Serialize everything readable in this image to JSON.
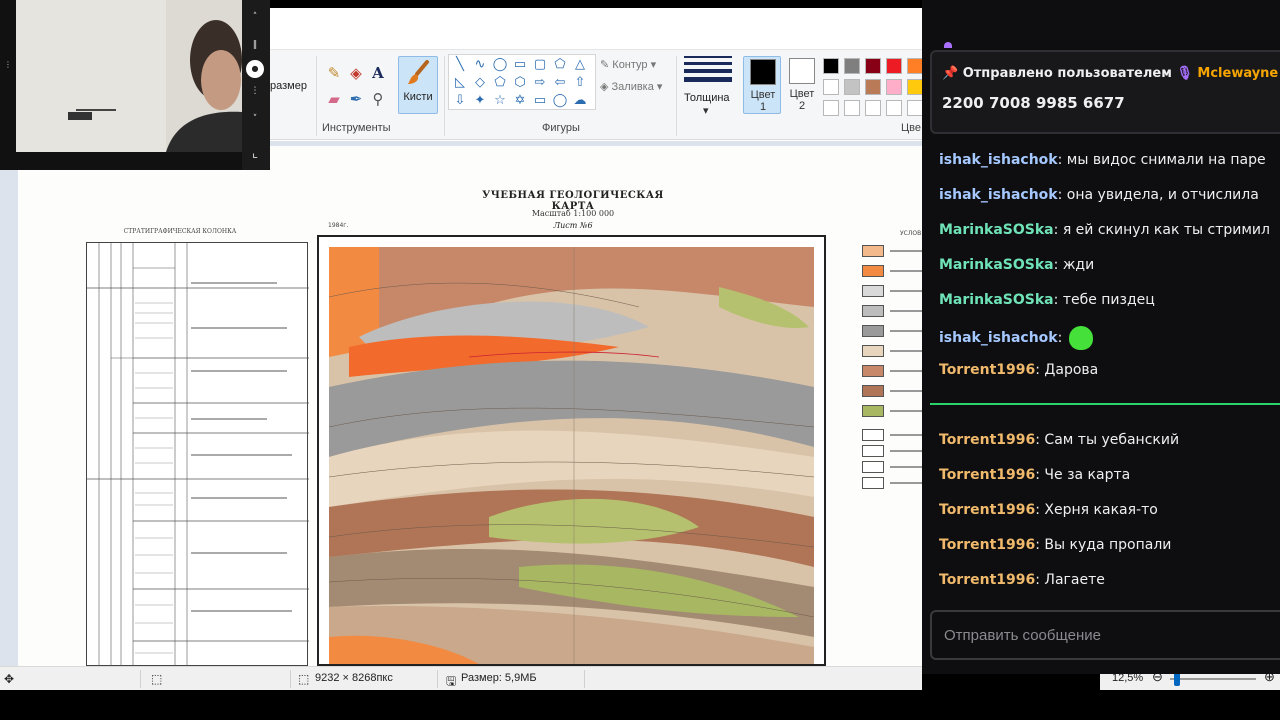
{
  "paint": {
    "ribbon": {
      "size_label": "размер",
      "tools_label": "Инструменты",
      "brushes_label": "Кисти",
      "shapes_label": "Фигуры",
      "outline_label": "Контур",
      "fill_label": "Заливка",
      "thickness_label": "Толщина",
      "color1_label": "Цвет\n1",
      "color2_label": "Цвет\n2",
      "colors_label": "Цве"
    },
    "palette": {
      "row1": [
        "#000000",
        "#7f7f7f",
        "#880015",
        "#ed1c24",
        "#ff7f27"
      ],
      "row2": [
        "#ffffff",
        "#c3c3c3",
        "#b97a57",
        "#ffaec9",
        "#ffc90e"
      ],
      "row3": [
        "#ffffff",
        "#ffffff",
        "#ffffff",
        "#ffffff",
        "#ffffff"
      ]
    },
    "color1": "#000000",
    "color2": "#ffffff",
    "document": {
      "map_title": "УЧЕБНАЯ ГЕОЛОГИЧЕСКАЯ КАРТА",
      "map_scale": "Масштаб 1:100 000",
      "map_sheet": "Лист №6",
      "strat_title": "СТРАТИГРАФИЧЕСКАЯ КОЛОНКА",
      "year": "1984г.",
      "legend_title": "УСЛОВ"
    },
    "status": {
      "dimensions": "9232 × 8268пкс",
      "file_size": "Размер: 5,9МБ",
      "zoom": "12,5%"
    }
  },
  "chat": {
    "pinned": {
      "prefix": "Отправлено пользователем",
      "user": "Mclewayne",
      "message": "2200 7008 9985 6677"
    },
    "messages": [
      {
        "user": "ishak_ishachok",
        "color": "#a4c8ff",
        "text": "мы видос снимали на паре"
      },
      {
        "user": "ishak_ishachok",
        "color": "#a4c8ff",
        "text": "она увидела, и отчислила"
      },
      {
        "user": "MarinkaSOSka",
        "color": "#6fe3b7",
        "text": "я ей скинул как ты стримил"
      },
      {
        "user": "MarinkaSOSka",
        "color": "#6fe3b7",
        "text": "жди"
      },
      {
        "user": "MarinkaSOSka",
        "color": "#6fe3b7",
        "text": "тебе пиздец"
      },
      {
        "user": "ishak_ishachok",
        "color": "#a4c8ff",
        "text": ""
      },
      {
        "user": "Torrent1996",
        "color": "#f0b96b",
        "text": "Дарова"
      },
      {
        "user": "Torrent1996",
        "color": "#f0b96b",
        "text": "Сам ты уебанский"
      },
      {
        "user": "Torrent1996",
        "color": "#f0b96b",
        "text": "Че за карта"
      },
      {
        "user": "Torrent1996",
        "color": "#f0b96b",
        "text": "Херня какая-то"
      },
      {
        "user": "Torrent1996",
        "color": "#f0b96b",
        "text": "Вы куда пропали"
      },
      {
        "user": "Torrent1996",
        "color": "#f0b96b",
        "text": "Лагаете"
      }
    ],
    "input_placeholder": "Отправить сообщение"
  }
}
